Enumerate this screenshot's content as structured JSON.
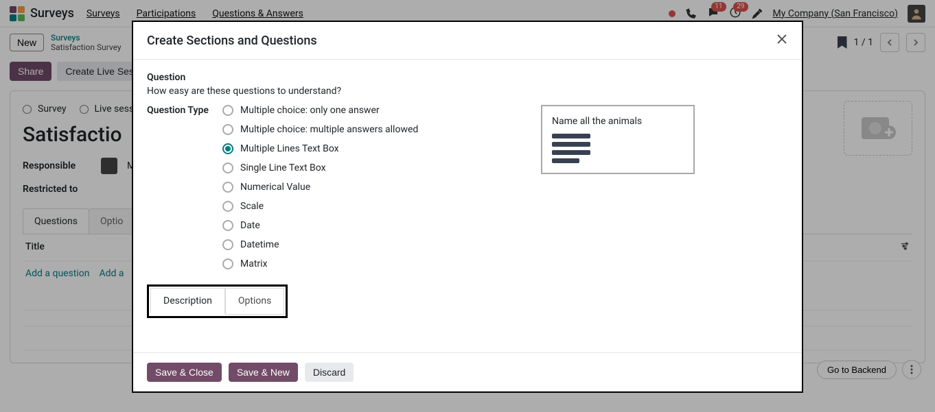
{
  "nav": {
    "brand": "Surveys",
    "links": [
      "Surveys",
      "Participations",
      "Questions & Answers"
    ],
    "chat_badge": "11",
    "activity_badge": "29",
    "company": "My Company (San Francisco)"
  },
  "subhdr": {
    "new": "New",
    "bc_top": "Surveys",
    "bc_bottom": "Satisfaction Survey",
    "pager": "1 / 1"
  },
  "actions": {
    "share": "Share",
    "live": "Create Live Sess"
  },
  "card": {
    "radio1": "Survey",
    "radio2": "Live sessi",
    "title": "Satisfactio",
    "responsible_label": "Responsible",
    "responsible_value": "M",
    "restricted_label": "Restricted to",
    "tabs": [
      "Questions",
      "Optio"
    ],
    "table_head": "Title",
    "add_q": "Add a question",
    "add_a": "Add a"
  },
  "bottom": {
    "goto": "Go to Backend"
  },
  "modal": {
    "title": "Create Sections and Questions",
    "q_label": "Question",
    "q_text": "How easy are these questions to understand?",
    "type_label": "Question Type",
    "types": [
      "Multiple choice: only one answer",
      "Multiple choice: multiple answers allowed",
      "Multiple Lines Text Box",
      "Single Line Text Box",
      "Numerical Value",
      "Scale",
      "Date",
      "Datetime",
      "Matrix"
    ],
    "selected_type_index": 2,
    "preview_title": "Name all the animals",
    "tabs": [
      "Description",
      "Options"
    ],
    "footer": {
      "save_close": "Save & Close",
      "save_new": "Save & New",
      "discard": "Discard"
    }
  }
}
